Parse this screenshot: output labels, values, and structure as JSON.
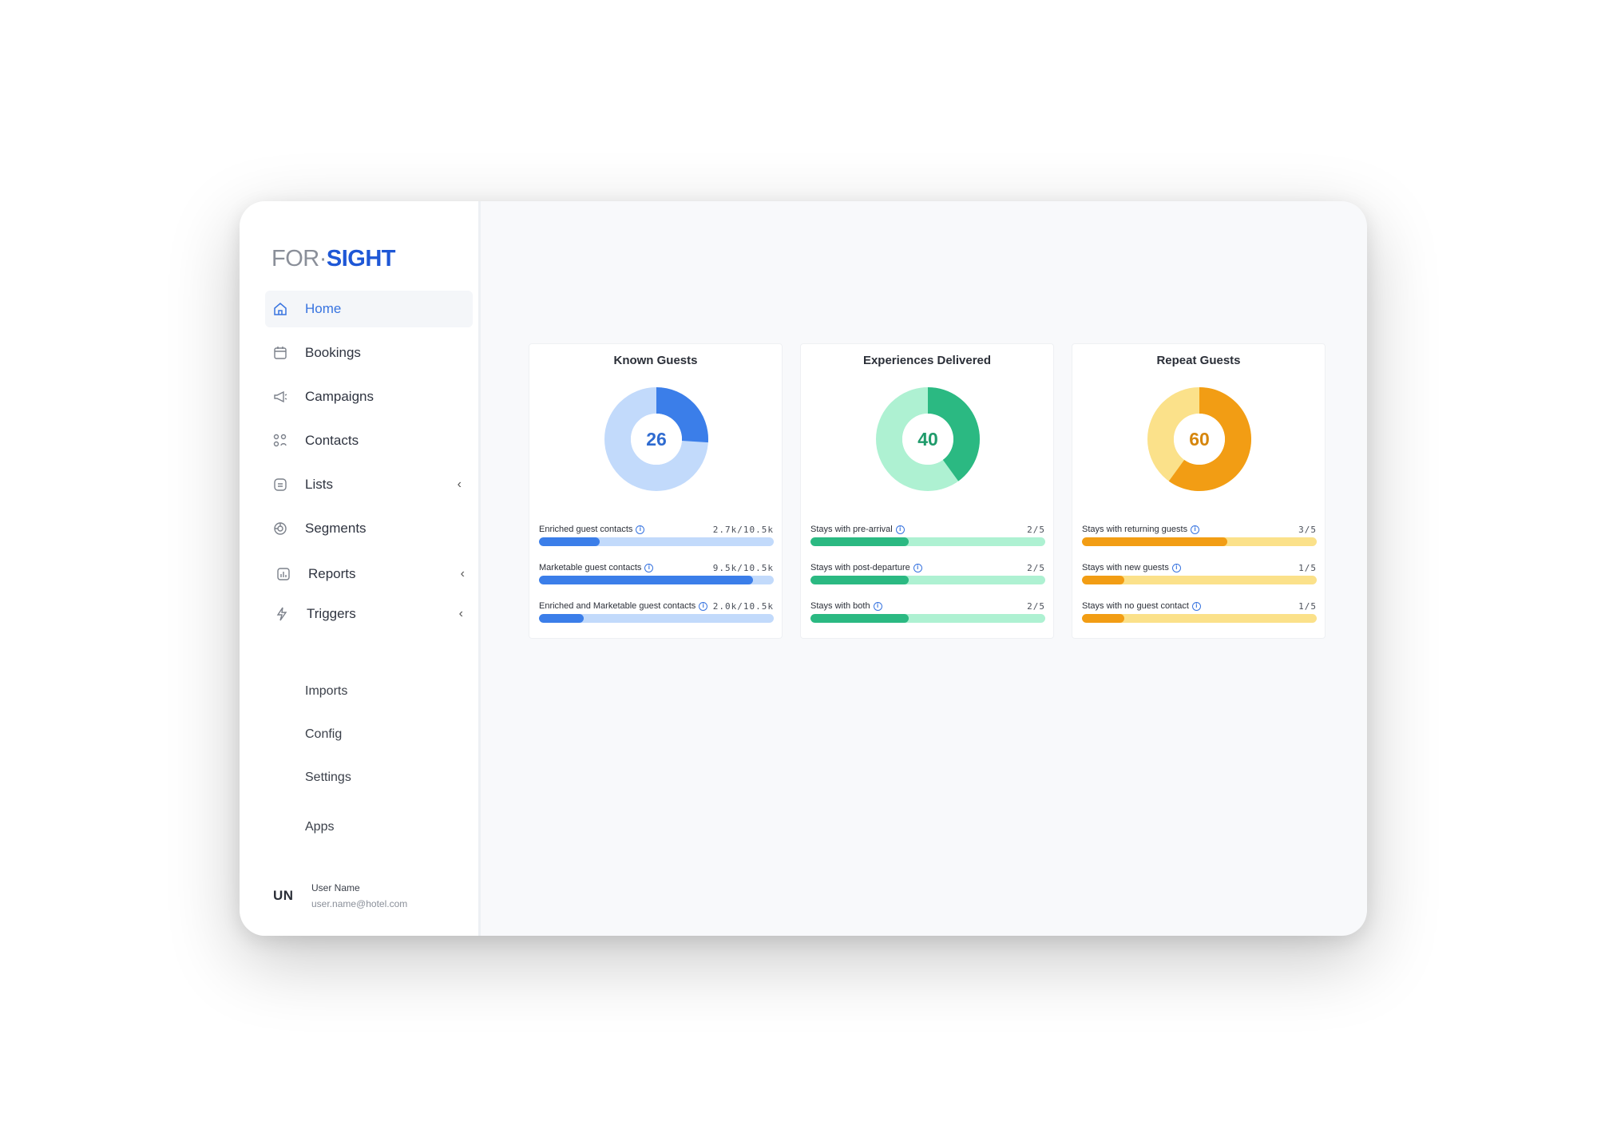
{
  "logo": {
    "part1": "FOR·",
    "part2": "SIGHT"
  },
  "nav": [
    {
      "label": "Home",
      "icon": "home-icon",
      "active": true
    },
    {
      "label": "Bookings",
      "icon": "calendar-icon"
    },
    {
      "label": "Campaigns",
      "icon": "megaphone-icon"
    },
    {
      "label": "Contacts",
      "icon": "contacts-icon"
    },
    {
      "label": "Lists",
      "icon": "list-icon",
      "chevron": "‹"
    },
    {
      "label": "Segments",
      "icon": "segments-icon"
    },
    {
      "label": "Reports",
      "icon": "reports-icon",
      "chevron": "‹"
    },
    {
      "label": "Triggers",
      "icon": "lightning-icon",
      "chevron": "‹"
    }
  ],
  "secondary_nav": [
    "Imports",
    "Config",
    "Settings",
    "Apps"
  ],
  "user": {
    "initials": "UN",
    "name": "User Name",
    "email": "user.name@hotel.com"
  },
  "cards": [
    {
      "title": "Known Guests",
      "value": "26",
      "percent": 26,
      "colors": {
        "primary": "#3b7ee9",
        "light": "#c2dafb",
        "text": "#2f6bd0"
      },
      "metrics": [
        {
          "label": "Enriched guest contacts",
          "value": "2.7k/10.5k",
          "fraction": 0.26
        },
        {
          "label": "Marketable guest contacts",
          "value": "9.5k/10.5k",
          "fraction": 0.91
        },
        {
          "label": "Enriched and Marketable guest contacts",
          "value": "2.0k/10.5k",
          "fraction": 0.19
        }
      ]
    },
    {
      "title": "Experiences Delivered",
      "value": "40",
      "percent": 40,
      "colors": {
        "primary": "#2bb982",
        "light": "#aef1d2",
        "text": "#1f9b6b"
      },
      "metrics": [
        {
          "label": "Stays with pre-arrival",
          "value": "2/5",
          "fraction": 0.42
        },
        {
          "label": "Stays with post-departure",
          "value": "2/5",
          "fraction": 0.42
        },
        {
          "label": "Stays with both",
          "value": "2/5",
          "fraction": 0.42
        }
      ]
    },
    {
      "title": "Repeat Guests",
      "value": "60",
      "percent": 60,
      "colors": {
        "primary": "#f29d14",
        "light": "#fbe18a",
        "text": "#d6860d"
      },
      "metrics": [
        {
          "label": "Stays with returning guests",
          "value": "3/5",
          "fraction": 0.62
        },
        {
          "label": "Stays with new guests",
          "value": "1/5",
          "fraction": 0.18
        },
        {
          "label": "Stays with no guest contact",
          "value": "1/5",
          "fraction": 0.18
        }
      ]
    }
  ]
}
